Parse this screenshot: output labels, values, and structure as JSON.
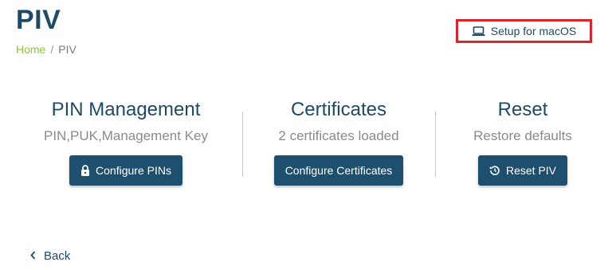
{
  "header": {
    "title": "PIV",
    "setup_link": {
      "label": "Setup for macOS",
      "icon": "laptop-icon"
    }
  },
  "breadcrumb": {
    "items": [
      "Home",
      "PIV"
    ],
    "separator": "/"
  },
  "sections": [
    {
      "title": "PIN Management",
      "subtitle": "PIN,PUK,Management Key",
      "button": {
        "label": "Configure PINs",
        "icon": "lock-icon"
      }
    },
    {
      "title": "Certificates",
      "subtitle": "2 certificates loaded",
      "button": {
        "label": "Configure Certificates"
      }
    },
    {
      "title": "Reset",
      "subtitle": "Restore defaults",
      "button": {
        "label": "Reset PIV",
        "icon": "reset-icon"
      }
    }
  ],
  "footer": {
    "back_label": "Back",
    "back_icon": "chevron-left-icon"
  },
  "colors": {
    "primary": "#1f4f6e",
    "breadcrumb_home": "#8cc63f",
    "highlight_border": "#d9262b"
  }
}
